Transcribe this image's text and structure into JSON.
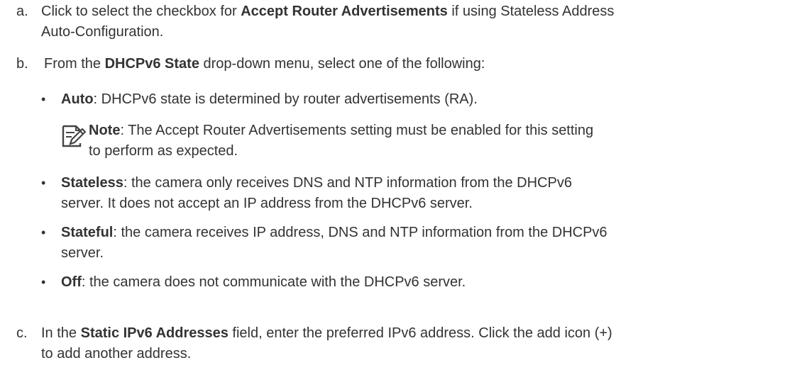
{
  "steps": [
    {
      "marker": "a.",
      "pre": "Click to select the checkbox for ",
      "bold": "Accept Router Advertisements",
      "post_line1": " if using Stateless Address",
      "line2": "Auto-Configuration."
    },
    {
      "marker": "b.",
      "pre": "From the ",
      "bold": "DHCPv6 State",
      "post": " drop-down menu, select one of the following:"
    },
    {
      "marker": "c.",
      "pre": "In the ",
      "bold": "Static IPv6 Addresses",
      "post_line1": " field, enter the preferred IPv6 address. Click the add icon (+)",
      "line2": "to add another address."
    }
  ],
  "options": [
    {
      "bold": "Auto",
      "line1": ": DHCPv6 state is determined by router advertisements (RA)."
    },
    {
      "bold": "Stateless",
      "line1": ": the camera only receives DNS and NTP information from the DHCPv6",
      "line2": "server. It does not accept an IP address from the DHCPv6 server."
    },
    {
      "bold": "Stateful",
      "line1": ": the camera receives IP address, DNS and NTP information from the DHCPv6",
      "line2": "server."
    },
    {
      "bold": "Off",
      "line1": ": the camera does not communicate with the DHCPv6 server."
    }
  ],
  "note": {
    "bold": "Note",
    "line1": ": The Accept Router Advertisements setting must be enabled for this setting",
    "line2": "to perform as expected.",
    "icon": "note-pencil-icon"
  }
}
